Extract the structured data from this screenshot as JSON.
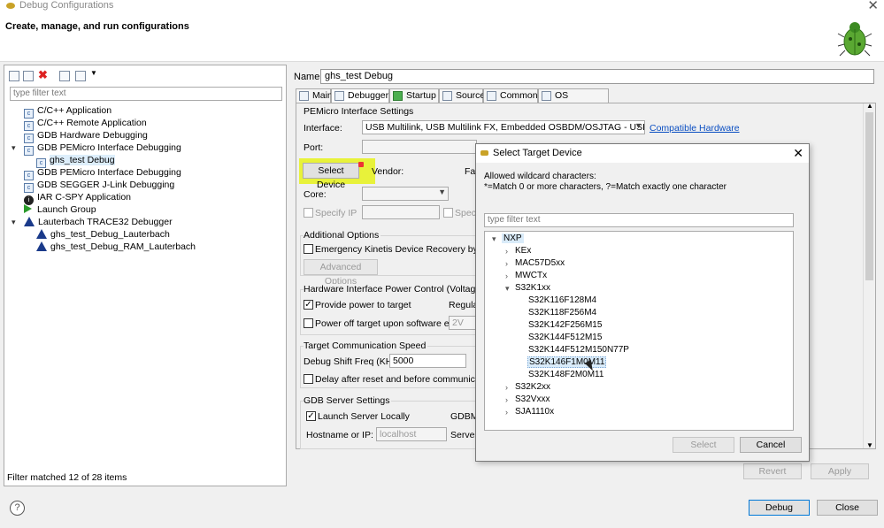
{
  "window": {
    "title": "Debug Configurations",
    "close": "✕"
  },
  "header": {
    "title": "Create, manage, and run configurations",
    "icon": "bug-icon"
  },
  "left": {
    "filter_placeholder": "type filter text",
    "tree": [
      {
        "label": "C/C++ Application",
        "icon": "c-icon"
      },
      {
        "label": "C/C++ Remote Application",
        "icon": "c-icon"
      },
      {
        "label": "GDB Hardware Debugging",
        "icon": "c-icon"
      },
      {
        "label": "GDB PEMicro Interface Debugging",
        "icon": "c-icon",
        "expanded": true
      },
      {
        "label": "ghs_test Debug",
        "icon": "c-icon",
        "selected": true
      },
      {
        "label": "GDB PEMicro Interface Debugging",
        "icon": "c-icon"
      },
      {
        "label": "GDB SEGGER J-Link Debugging",
        "icon": "c-icon"
      },
      {
        "label": "IAR C-SPY Application",
        "icon": "iar-icon"
      },
      {
        "label": "Launch Group",
        "icon": "launch-icon"
      },
      {
        "label": "Lauterbach TRACE32 Debugger",
        "icon": "triangle-icon",
        "expanded": true
      },
      {
        "label": "ghs_test_Debug_Lauterbach",
        "icon": "triangle-icon"
      },
      {
        "label": "ghs_test_Debug_RAM_Lauterbach",
        "icon": "triangle-icon"
      }
    ],
    "status": "Filter matched 12 of 28 items"
  },
  "right": {
    "name_label": "Name:",
    "name_value": "ghs_test Debug",
    "tabs": [
      "Main",
      "Debugger",
      "Startup",
      "Source",
      "Common",
      "OS Awareness"
    ],
    "pemicro_title": "PEMicro Interface Settings",
    "interface_label": "Interface:",
    "interface_value": "USB Multilink, USB Multilink FX, Embedded OSBDM/OSJTAG - USB Port",
    "compatible_hw": "Compatible Hardware",
    "port_label": "Port:",
    "select_device": "Select Device",
    "vendor_label": "Vendor:",
    "fam_label": "Fa",
    "core_label": "Core:",
    "specify_ip": "Specify IP",
    "specify2": "Specif",
    "additional_title": "Additional Options",
    "emergency": "Emergency Kinetis Device Recovery by Full C",
    "advanced_btn": "Advanced Options",
    "power_title": "Hardware Interface Power Control (Voltage -->",
    "provide_power": "Provide power to target",
    "regulat": "Regulat",
    "power_off": "Power off target upon software exit",
    "power_off_value": "2V",
    "comm_title": "Target Communication Speed",
    "shift_label": "Debug Shift Freq (KHz)",
    "shift_value": "5000",
    "delay": "Delay after reset and before communicating",
    "gdb_title": "GDB Server Settings",
    "launch_locally": "Launch Server Locally",
    "gdbm": "GDBM",
    "host_label": "Hostname or IP:",
    "host_value": "localhost",
    "server_label": "Server",
    "revert": "Revert",
    "apply": "Apply"
  },
  "dialog": {
    "title": "Select Target Device",
    "description": "Allowed wildcard characters:\n*=Match 0 or more characters, ?=Match exactly one character",
    "filter_placeholder": "type filter text",
    "tree": [
      {
        "label": "NXP",
        "level": 0,
        "expanded": true
      },
      {
        "label": "KEx",
        "level": 1
      },
      {
        "label": "MAC57D5xx",
        "level": 1
      },
      {
        "label": "MWCTx",
        "level": 1
      },
      {
        "label": "S32K1xx",
        "level": 1,
        "expanded": true
      },
      {
        "label": "S32K116F128M4",
        "level": 2
      },
      {
        "label": "S32K118F256M4",
        "level": 2
      },
      {
        "label": "S32K142F256M15",
        "level": 2
      },
      {
        "label": "S32K144F512M15",
        "level": 2
      },
      {
        "label": "S32K144F512M150N77P",
        "level": 2
      },
      {
        "label": "S32K146F1M0M11",
        "level": 2,
        "hover": true
      },
      {
        "label": "S32K148F2M0M11",
        "level": 2
      },
      {
        "label": "S32K2xx",
        "level": 1
      },
      {
        "label": "S32Vxxx",
        "level": 1
      },
      {
        "label": "SJA1110x",
        "level": 1
      }
    ],
    "select_btn": "Select",
    "cancel_btn": "Cancel"
  },
  "footer": {
    "debug": "Debug",
    "close": "Close",
    "help": "?"
  }
}
